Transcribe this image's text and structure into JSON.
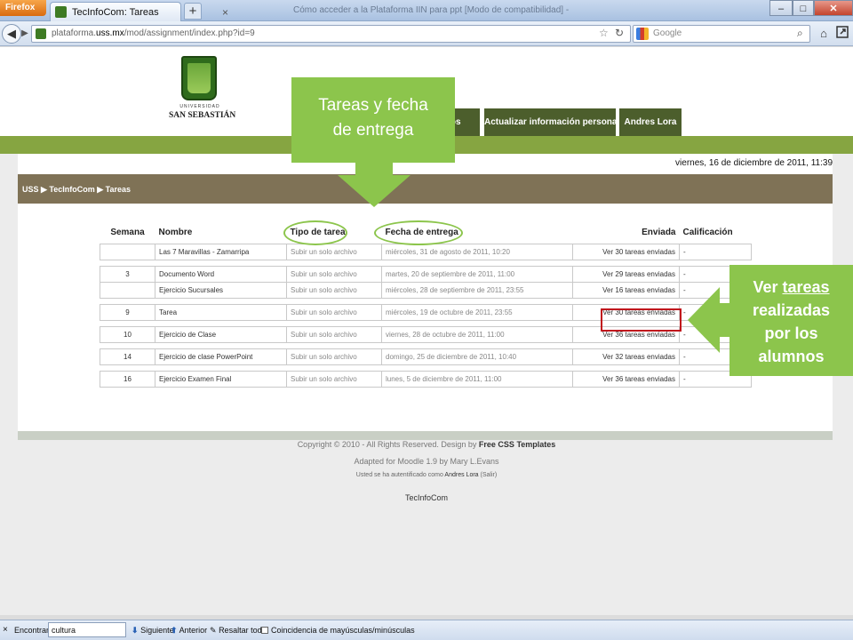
{
  "browser": {
    "firefox_button": "Firefox",
    "tab_title": "TecInfoCom: Tareas",
    "tab_close": "×",
    "new_tab": "+",
    "window_title": "Cómo acceder a la Plataforma IIN para ppt [Modo de compatibilidad] - Microsoft PowerPoint",
    "url_prefix": "plataforma.",
    "url_domain": "uss.mx",
    "url_path": "/mod/assignment/index.php?id=9",
    "search_placeholder": "Google",
    "min_glyph": "–",
    "max_glyph": "□",
    "close_glyph": "✕",
    "back_glyph": "◀",
    "forward_glyph": "▶",
    "star_glyph": "☆",
    "reload_glyph": "↻",
    "search_glyph": "⌕",
    "home_glyph": "⌂"
  },
  "site": {
    "logo_small": "UNIVERSIDAD",
    "logo_name": "SAN SEBASTIÁN",
    "nav": [
      {
        "label": "ursos"
      },
      {
        "label": "Actualizar información personal"
      },
      {
        "label": "Andres Lora"
      }
    ],
    "date": "viernes, 16 de diciembre de 2011, 11:39",
    "breadcrumb": "USS ▶ TecInfoCom ▶ Tareas"
  },
  "table": {
    "headers": {
      "week": "Semana",
      "name": "Nombre",
      "type": "Tipo de tarea",
      "due": "Fecha de entrega",
      "submitted": "Enviada",
      "grade": "Calificación"
    },
    "rows": [
      {
        "week": "",
        "name": "Las 7 Maravillas - Zamarripa",
        "type": "Subir un solo archivo",
        "due": "miércoles, 31 de agosto de 2011, 10:20",
        "submitted": "Ver 30 tareas enviadas",
        "grade": "-"
      },
      {
        "week": "3",
        "name": "Documento Word",
        "type": "Subir un solo archivo",
        "due": "martes, 20 de septiembre de 2011, 11:00",
        "submitted": "Ver 29 tareas enviadas",
        "grade": "-"
      },
      {
        "week": "",
        "name": "Ejercicio Sucursales",
        "type": "Subir un solo archivo",
        "due": "miércoles, 28 de septiembre de 2011, 23:55",
        "submitted": "Ver 16 tareas enviadas",
        "grade": "-"
      },
      {
        "week": "9",
        "name": "Tarea",
        "type": "Subir un solo archivo",
        "due": "miércoles, 19 de octubre de 2011, 23:55",
        "submitted": "Ver 30 tareas enviadas",
        "grade": "-"
      },
      {
        "week": "10",
        "name": "Ejercicio de Clase",
        "type": "Subir un solo archivo",
        "due": "viernes, 28 de octubre de 2011, 11:00",
        "submitted": "Ver 36 tareas enviadas",
        "grade": "-"
      },
      {
        "week": "14",
        "name": "Ejercicio de clase PowerPoint",
        "type": "Subir un solo archivo",
        "due": "domingo, 25 de diciembre de 2011, 10:40",
        "submitted": "Ver 32 tareas enviadas",
        "grade": "-"
      },
      {
        "week": "16",
        "name": "Ejercicio Examen Final",
        "type": "Subir un solo archivo",
        "due": "lunes, 5 de diciembre de 2011, 11:00",
        "submitted": "Ver 36 tareas enviadas",
        "grade": "-"
      }
    ]
  },
  "footer": {
    "copyright": "Copyright © 2010 - All Rights Reserved. Design by ",
    "design_link": "Free CSS Templates",
    "moodle": "Adapted for Moodle 1.9 by Mary L.Evans",
    "auth_prefix": "Usted se ha autentificado como ",
    "auth_user": "Andres Lora",
    "auth_logout": "(Salir)",
    "site_name": "TecInfoCom"
  },
  "annotations": {
    "left_callout_line1": "Tareas y fecha",
    "left_callout_line2": "de entrega",
    "right_callout_ver": "Ver ",
    "right_callout_tareas": "tareas",
    "right_callout_line2": "realizadas",
    "right_callout_line3": "por los",
    "right_callout_line4": "alumnos",
    "colors": {
      "callout": "#8cc54c",
      "highlight": "#c0141c"
    }
  },
  "findbar": {
    "close": "×",
    "label": "Encontrar:",
    "value": "cultura",
    "next": "Siguiente",
    "prev": "Anterior",
    "highlight": "Resaltar todo",
    "match_case": "Coincidencia de mayúsculas/minúsculas"
  }
}
